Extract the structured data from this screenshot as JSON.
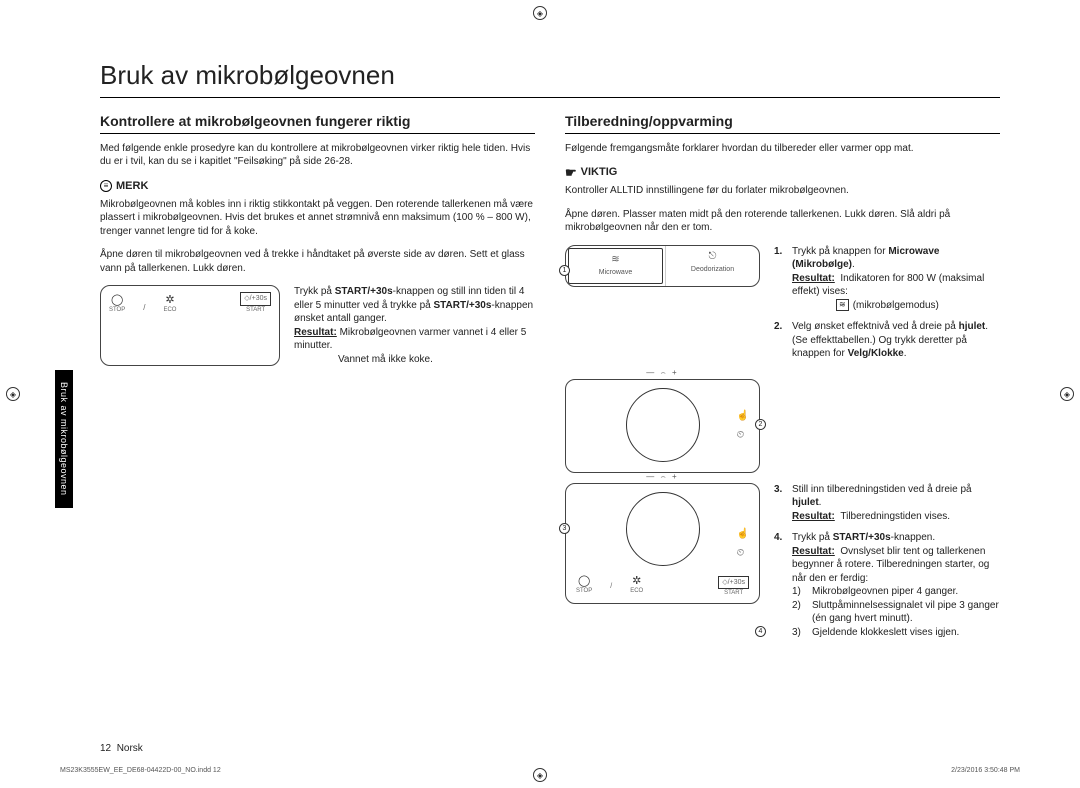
{
  "title": "Bruk av mikrobølgeovnen",
  "side_tab": "Bruk av mikrobølgeovnen",
  "left": {
    "heading": "Kontrollere at mikrobølgeovnen fungerer riktig",
    "intro": "Med følgende enkle prosedyre kan du kontrollere at mikrobølgeovnen virker riktig hele tiden. Hvis du er i tvil, kan du se i kapitlet \"Feilsøking\" på side 26-28.",
    "note_label": "MERK",
    "note_text": "Mikrobølgeovnen må kobles inn i riktig stikkontakt på veggen. Den roterende tallerkenen må være plassert i mikrobølgeovnen. Hvis det brukes et annet strømnivå enn maksimum (100 % – 800 W), trenger vannet lengre tid for å koke.",
    "open_door": "Åpne døren til mikrobølgeovnen ved å trekke i håndtaket på øverste side av døren. Sett et glass vann på tallerkenen. Lukk døren.",
    "panel": {
      "stop": "STOP",
      "eco": "ECO",
      "start": "START",
      "start_btn": "/+30s",
      "stop_glyph": "◯",
      "eco_glyph": "✲",
      "start_glyph": "◇"
    },
    "steps_text": {
      "line1_a": "Trykk på ",
      "line1_b": "START/+30s",
      "line1_c": "-knappen og still inn tiden til 4 eller 5 minutter ved å trykke på ",
      "line1_d": "START/+30s",
      "line1_e": "-knappen ønsket antall ganger.",
      "result_label": "Resultat:",
      "result_text": " Mikrobølgeovnen varmer vannet i 4 eller 5 minutter.",
      "tail": "Vannet må ikke koke."
    }
  },
  "right": {
    "heading": "Tilberedning/oppvarming",
    "intro": "Følgende fremgangsmåte forklarer hvordan du tilbereder eller varmer opp mat.",
    "important_label": "VIKTIG",
    "important_text": "Kontroller ALLTID innstillingene før du forlater mikrobølgeovnen.",
    "open_place": "Åpne døren. Plasser maten midt på den roterende tallerkenen. Lukk døren. Slå aldri på mikrobølgeovnen når den er tom.",
    "modes": {
      "microwave": "Microwave",
      "deodorization": "Deodorization",
      "mw_glyph": "≋",
      "deo_glyph": "⎋"
    },
    "step1": {
      "num": "1.",
      "text_a": "Trykk på knappen for ",
      "text_b": "Microwave (Mikrobølge)",
      "text_c": ".",
      "result_label": "Resultat:",
      "result_text_a": "Indikatoren for 800 W (maksimal effekt) vises:",
      "result_text_b": "(mikrobølgemodus)"
    },
    "step2": {
      "num": "2.",
      "text_a": "Velg ønsket effektnivå ved å dreie på ",
      "text_b": "hjulet",
      "text_c": ". (Se effekttabellen.) Og trykk deretter på knappen for ",
      "text_d": "Velg/Klokke",
      "text_e": "."
    },
    "step3": {
      "num": "3.",
      "text_a": "Still inn tilberedningstiden ved å dreie på ",
      "text_b": "hjulet",
      "text_c": ".",
      "result_label": "Resultat:",
      "result_text": "Tilberedningstiden vises."
    },
    "step4": {
      "num": "4.",
      "text_a": "Trykk på ",
      "text_b": "START/+30s",
      "text_c": "-knappen.",
      "result_label": "Resultat:",
      "result_text": "Ovnslyset blir tent og tallerkenen begynner å rotere. Tilberedningen starter, og når den er ferdig:",
      "sub": [
        {
          "n": "1)",
          "t": "Mikrobølgeovnen piper 4 ganger."
        },
        {
          "n": "2)",
          "t": "Sluttpåminnelsessignalet vil pipe 3 ganger (én gang hvert minutt)."
        },
        {
          "n": "3)",
          "t": "Gjeldende klokkeslett vises igjen."
        }
      ]
    },
    "dial_side_icons": {
      "hand": "☝",
      "clock": "⏲"
    },
    "panel": {
      "stop": "STOP",
      "eco": "ECO",
      "start": "START",
      "start_btn": "/+30s"
    },
    "markers": {
      "m1": "1",
      "m2": "2",
      "m3": "3",
      "m4": "4"
    }
  },
  "footer": {
    "page": "12",
    "lang": "Norsk",
    "fine_left": "MS23K3555EW_EE_DE68-04422D-00_NO.indd   12",
    "fine_right": "2/23/2016   3:50:48 PM"
  }
}
